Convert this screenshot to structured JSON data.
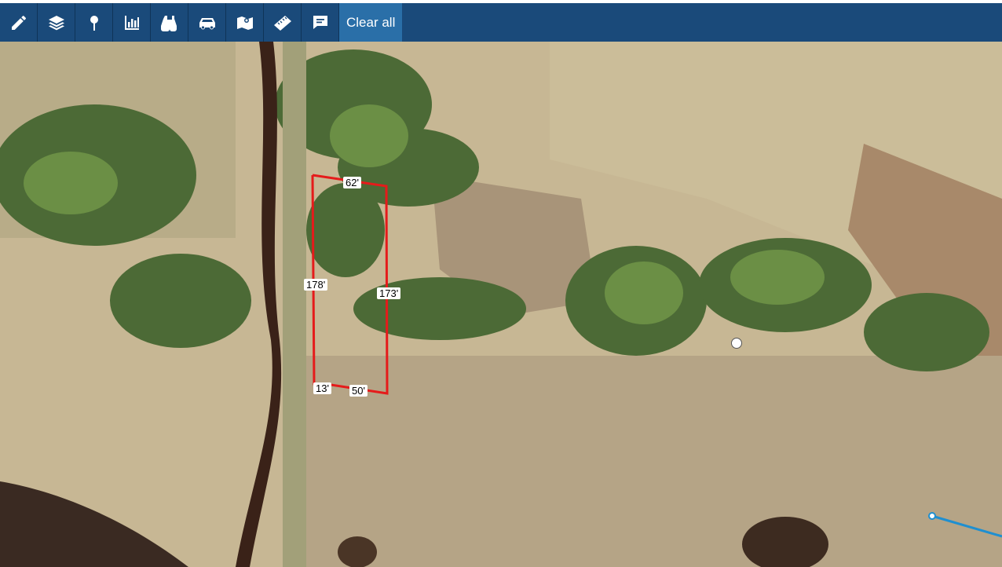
{
  "toolbar": {
    "tools": [
      {
        "name": "pencil-icon",
        "title": "Draw"
      },
      {
        "name": "layers-icon",
        "title": "Layers"
      },
      {
        "name": "pin-icon",
        "title": "Pin"
      },
      {
        "name": "chart-icon",
        "title": "Chart"
      },
      {
        "name": "binoculars-icon",
        "title": "Explore"
      },
      {
        "name": "car-icon",
        "title": "Drive"
      },
      {
        "name": "map-icon",
        "title": "Map"
      },
      {
        "name": "ruler-icon",
        "title": "Measure"
      },
      {
        "name": "comment-icon",
        "title": "Comment"
      }
    ],
    "clear_label": "Clear all"
  },
  "map": {
    "parcel": {
      "edges": {
        "top": "62'",
        "left": "178'",
        "right": "173'",
        "bottom_left": "13'",
        "bottom": "50'"
      },
      "outline_color": "#e51b1b"
    },
    "route_color": "#1f8fd0"
  }
}
